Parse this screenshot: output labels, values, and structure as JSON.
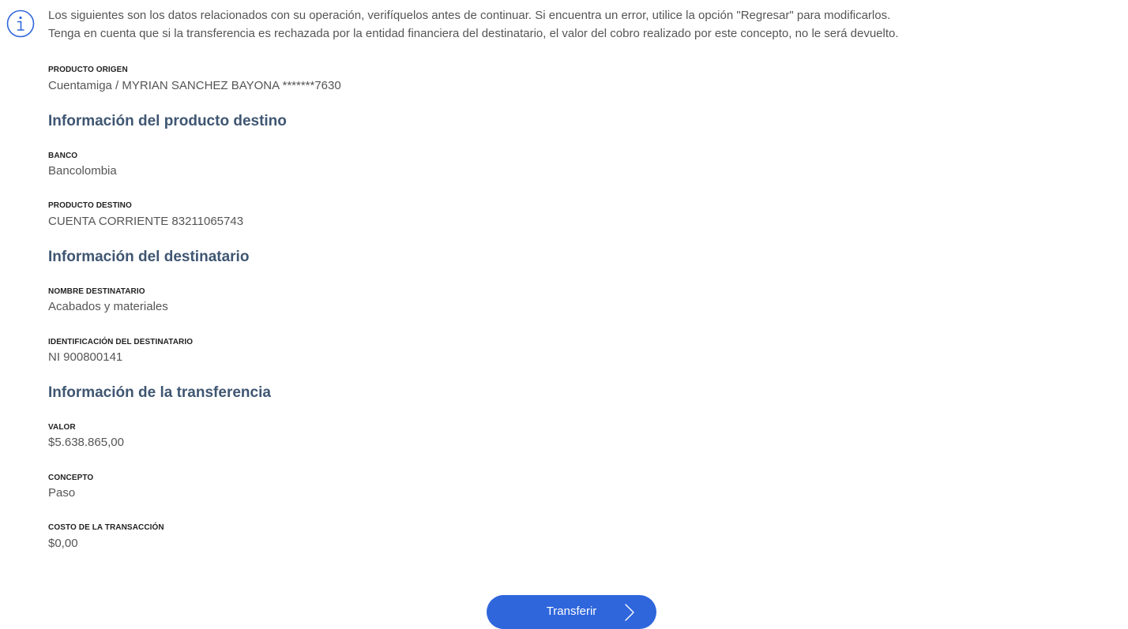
{
  "notice": {
    "line1": "Los siguientes son los datos relacionados con su operación, verifíquelos antes de continuar. Si encuentra un error, utilice la opción \"Regresar\" para modificarlos.",
    "line2": "Tenga en cuenta que si la transferencia es rechazada por la entidad financiera del destinatario, el valor del cobro realizado por este concepto, no le será devuelto."
  },
  "origin": {
    "label": "PRODUCTO ORIGEN",
    "value": "Cuentamiga / MYRIAN SANCHEZ BAYONA *******7630"
  },
  "destination_section": {
    "title": "Información del producto destino",
    "bank_label": "BANCO",
    "bank_value": "Bancolombia",
    "product_label": "PRODUCTO DESTINO",
    "product_value": "CUENTA CORRIENTE 83211065743"
  },
  "recipient_section": {
    "title": "Información del destinatario",
    "name_label": "NOMBRE DESTINATARIO",
    "name_value": "Acabados y materiales",
    "id_label": "IDENTIFICACIÓN DEL DESTINATARIO",
    "id_value": "NI 900800141"
  },
  "transfer_section": {
    "title": "Información de la transferencia",
    "amount_label": "VALOR",
    "amount_value": "$5.638.865,00",
    "concept_label": "CONCEPTO",
    "concept_value": "Paso",
    "cost_label": "COSTO DE LA TRANSACCIÓN",
    "cost_value": "$0,00"
  },
  "actions": {
    "transfer_label": "Transferir",
    "transfer_icon": "chevron-right-icon"
  },
  "colors": {
    "accent": "#2f66dc",
    "section_title": "#3f5672",
    "info_icon": "#2f66dc"
  }
}
